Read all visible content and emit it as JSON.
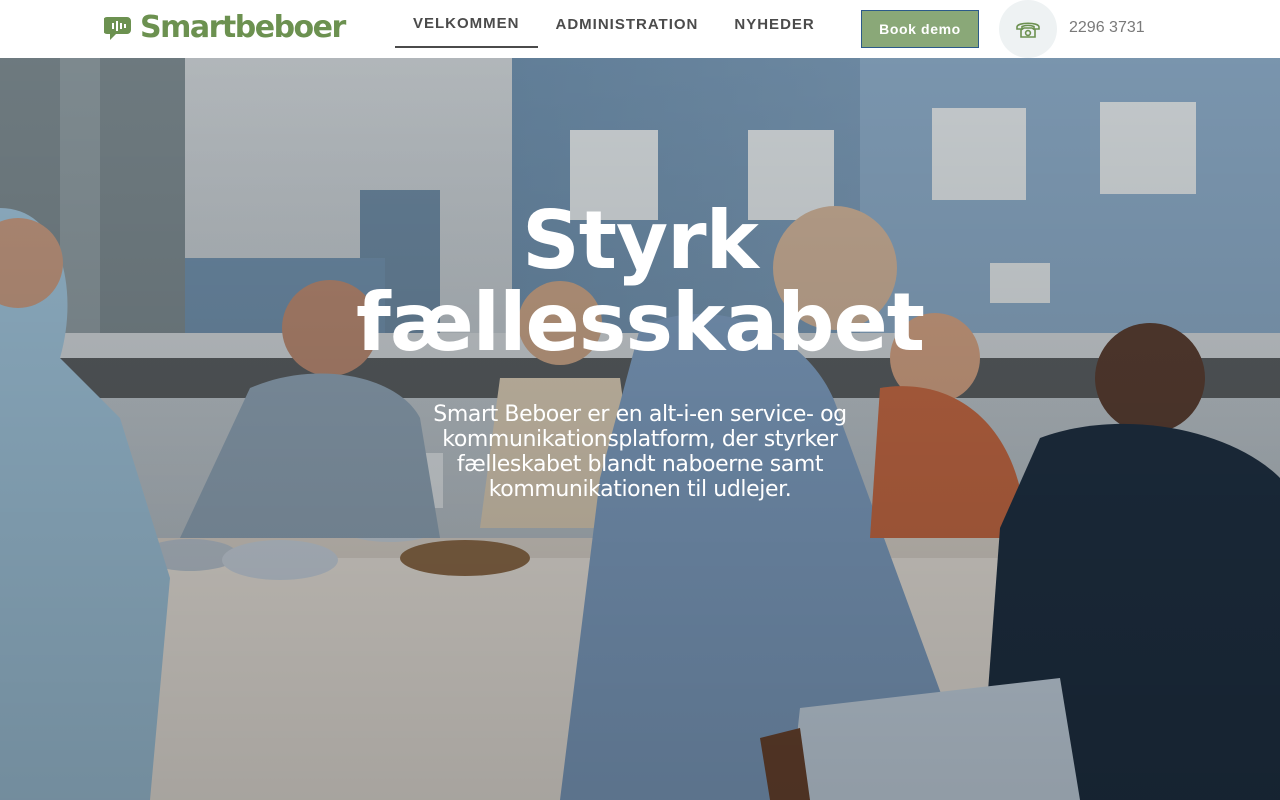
{
  "brand": {
    "name": "Smartbeboer",
    "color": "#6c9150"
  },
  "nav": {
    "items": [
      {
        "label": "VELKOMMEN",
        "active": true
      },
      {
        "label": "ADMINISTRATION",
        "active": false
      },
      {
        "label": "NYHEDER",
        "active": false
      }
    ]
  },
  "cta": {
    "book_label": "Book demo",
    "color": "#8aa878"
  },
  "contact": {
    "phone_icon": "phone-icon",
    "phone": "2296 3731"
  },
  "hero": {
    "title_line1": "Styrk",
    "title_line2": "fællesskabet",
    "subtitle": "Smart Beboer er en alt-i-en service- og kommunikationsplatform, der styrker fælleskabet blandt naboerne samt kommunikationen til udlejer."
  }
}
